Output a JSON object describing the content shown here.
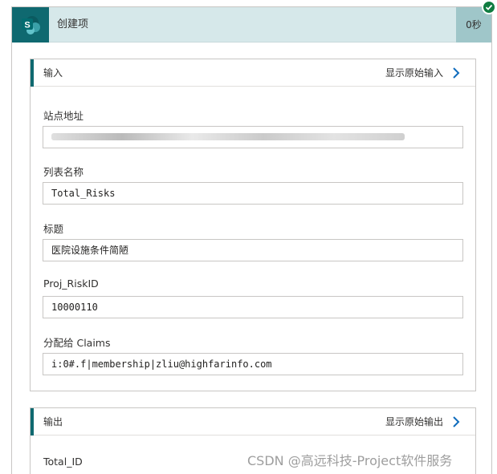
{
  "header": {
    "title": "创建项",
    "duration": "0秒",
    "app_icon": "sharepoint-icon",
    "status_icon": "success-check-icon",
    "accent_color": "#0f6970",
    "status_color": "#107c41"
  },
  "inputs_section": {
    "title": "输入",
    "raw_link": "显示原始输入",
    "fields": {
      "site_address": {
        "label": "站点地址",
        "value": ""
      },
      "list_name": {
        "label": "列表名称",
        "value": "Total_Risks"
      },
      "title": {
        "label": "标题",
        "value": "医院设施条件简陋"
      },
      "proj_risk_id": {
        "label": "Proj_RiskID",
        "value": "10000110"
      },
      "assigned_to": {
        "label": "分配给 Claims",
        "value": "i:0#.f|membership|zliu@highfarinfo.com"
      }
    }
  },
  "outputs_section": {
    "title": "输出",
    "raw_link": "显示原始输出",
    "fields": {
      "total_id": {
        "label": "Total_ID"
      }
    }
  },
  "watermark": "CSDN @高远科技-Project软件服务"
}
